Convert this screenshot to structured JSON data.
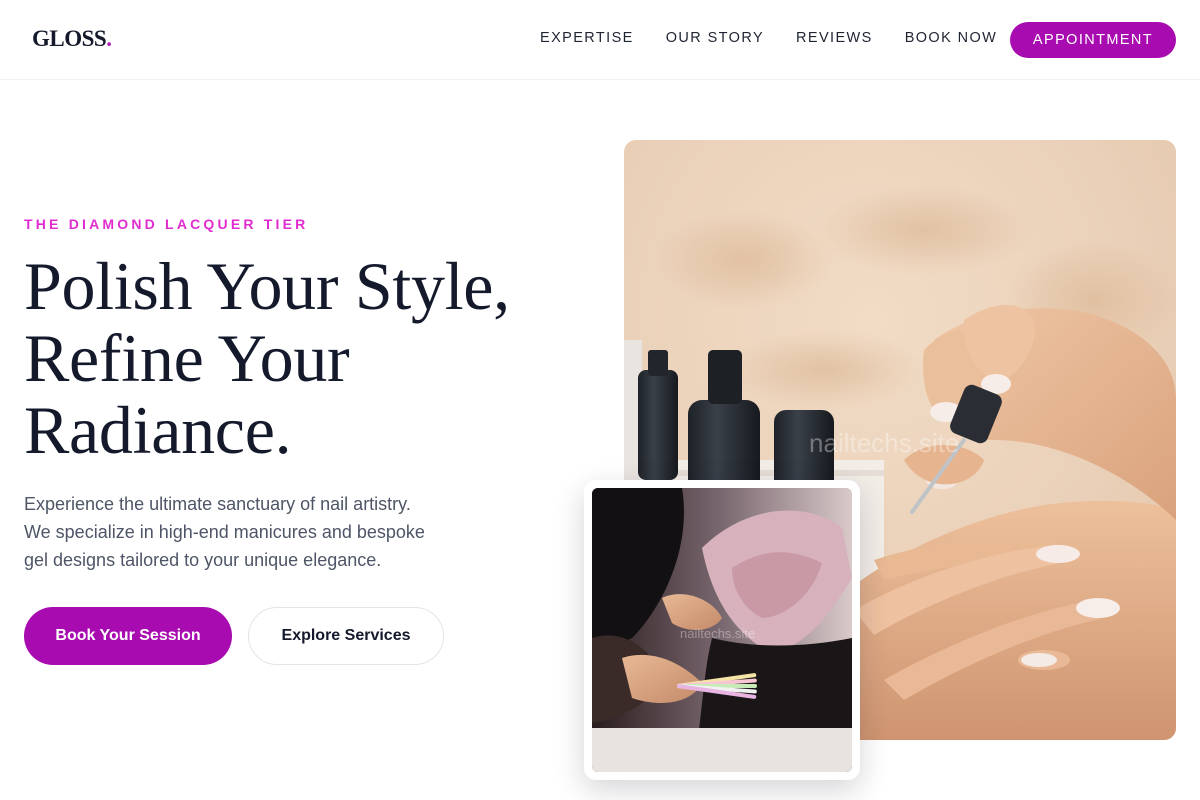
{
  "header": {
    "logo_text": "GLOSS",
    "logo_dot": ".",
    "nav": [
      {
        "label": "EXPERTISE"
      },
      {
        "label": "OUR STORY"
      },
      {
        "label": "REVIEWS"
      },
      {
        "label": "BOOK NOW"
      }
    ],
    "cta_label": "APPOINTMENT"
  },
  "hero": {
    "eyebrow": "THE DIAMOND LACQUER TIER",
    "headline_lines": [
      "Polish Your Style,",
      "Refine Your",
      "Radiance."
    ],
    "lede_lines": [
      "Experience the ultimate sanctuary of nail artistry.",
      "We specialize in high-end manicures and bespoke",
      "gel designs tailored to your unique elegance."
    ],
    "primary_cta": "Book Your Session",
    "secondary_cta": "Explore Services"
  },
  "images": {
    "main_watermark": "nailtechs.site",
    "inset_watermark": "nailtechs.site"
  },
  "colors": {
    "accent": "#a80bb0",
    "eyebrow": "#e02bd0",
    "heading": "#141a2b",
    "body_text": "#4d5566"
  }
}
